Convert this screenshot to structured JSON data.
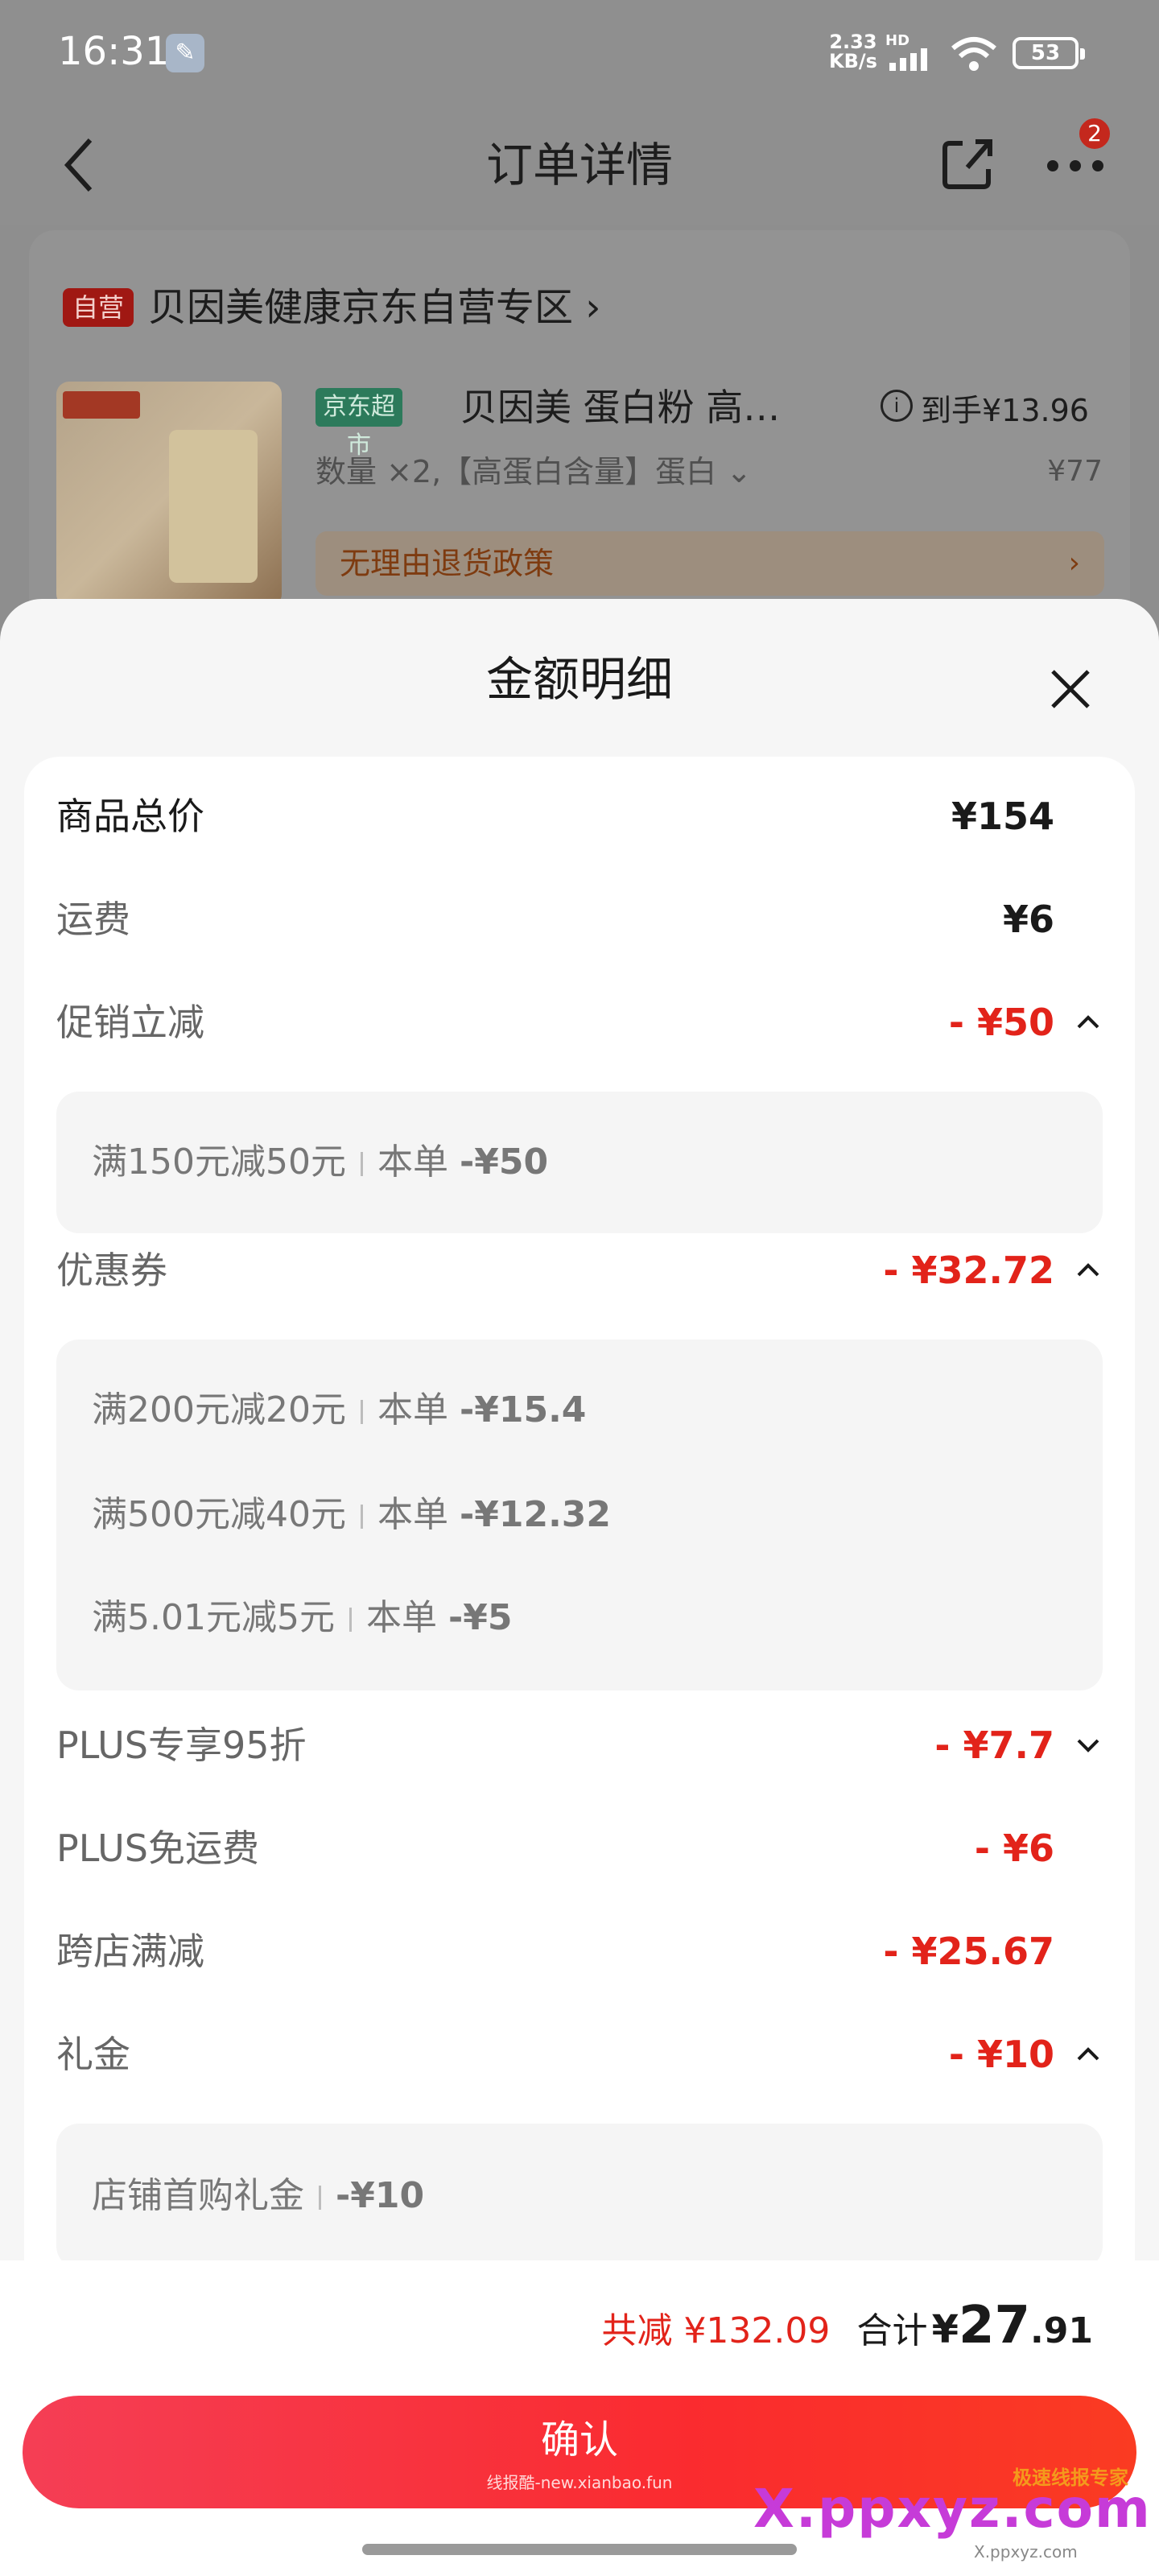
{
  "status_bar": {
    "time": "16:31",
    "net_speed": "2.33",
    "net_unit": "KB/s",
    "hd": "HD",
    "battery": "53"
  },
  "nav": {
    "title": "订单详情",
    "badge_count": "2"
  },
  "order": {
    "self_tag": "自营",
    "shop_name": "贝因美健康京东自营专区 ›",
    "product_tag": "京东超市",
    "product_name": "贝因美 蛋白粉 高…",
    "to_hand_label": "到手¥13.96",
    "spec": "数量 ×2,【高蛋白含量】蛋白 ⌄",
    "orig_price": "¥77",
    "return_policy": "无理由退货政策",
    "return_arrow": "›"
  },
  "sheet": {
    "title": "金额明细",
    "rows": [
      {
        "label": "商品总价",
        "amount": "¥154"
      },
      {
        "label": "运费",
        "amount": "¥6"
      },
      {
        "label": "促销立减",
        "amount": "- ¥50"
      },
      {
        "label": "优惠券",
        "amount": "- ¥32.72"
      },
      {
        "label": "PLUS专享95折",
        "amount": "- ¥7.7"
      },
      {
        "label": "PLUS免运费",
        "amount": "- ¥6"
      },
      {
        "label": "跨店满减",
        "amount": "- ¥25.67"
      },
      {
        "label": "礼金",
        "amount": "- ¥10"
      }
    ],
    "promo_details": [
      {
        "rule": "满150元减50元",
        "prefix": "本单",
        "amount": "-¥50"
      }
    ],
    "coupon_details": [
      {
        "rule": "满200元减20元",
        "prefix": "本单",
        "amount": "-¥15.4"
      },
      {
        "rule": "满500元减40元",
        "prefix": "本单",
        "amount": "-¥12.32"
      },
      {
        "rule": "满5.01元减5元",
        "prefix": "本单",
        "amount": "-¥5"
      }
    ],
    "gift_details": [
      {
        "rule": "店铺首购礼金",
        "amount": "-¥10"
      }
    ]
  },
  "footer": {
    "saved": "共减 ¥132.09",
    "sum_label": "合计",
    "sum_yen": "¥",
    "sum_int": "27",
    "sum_dec": ".91",
    "confirm": "确认",
    "watermark": "线报酷-new.xianbao.fun",
    "logo_main": "X.ppxyz.com",
    "logo_side": "极速线报专家",
    "logo_url": "X.ppxyz.com"
  },
  "colors": {
    "accent_red": "#e2231a",
    "button_gradient": "#f53e55"
  }
}
